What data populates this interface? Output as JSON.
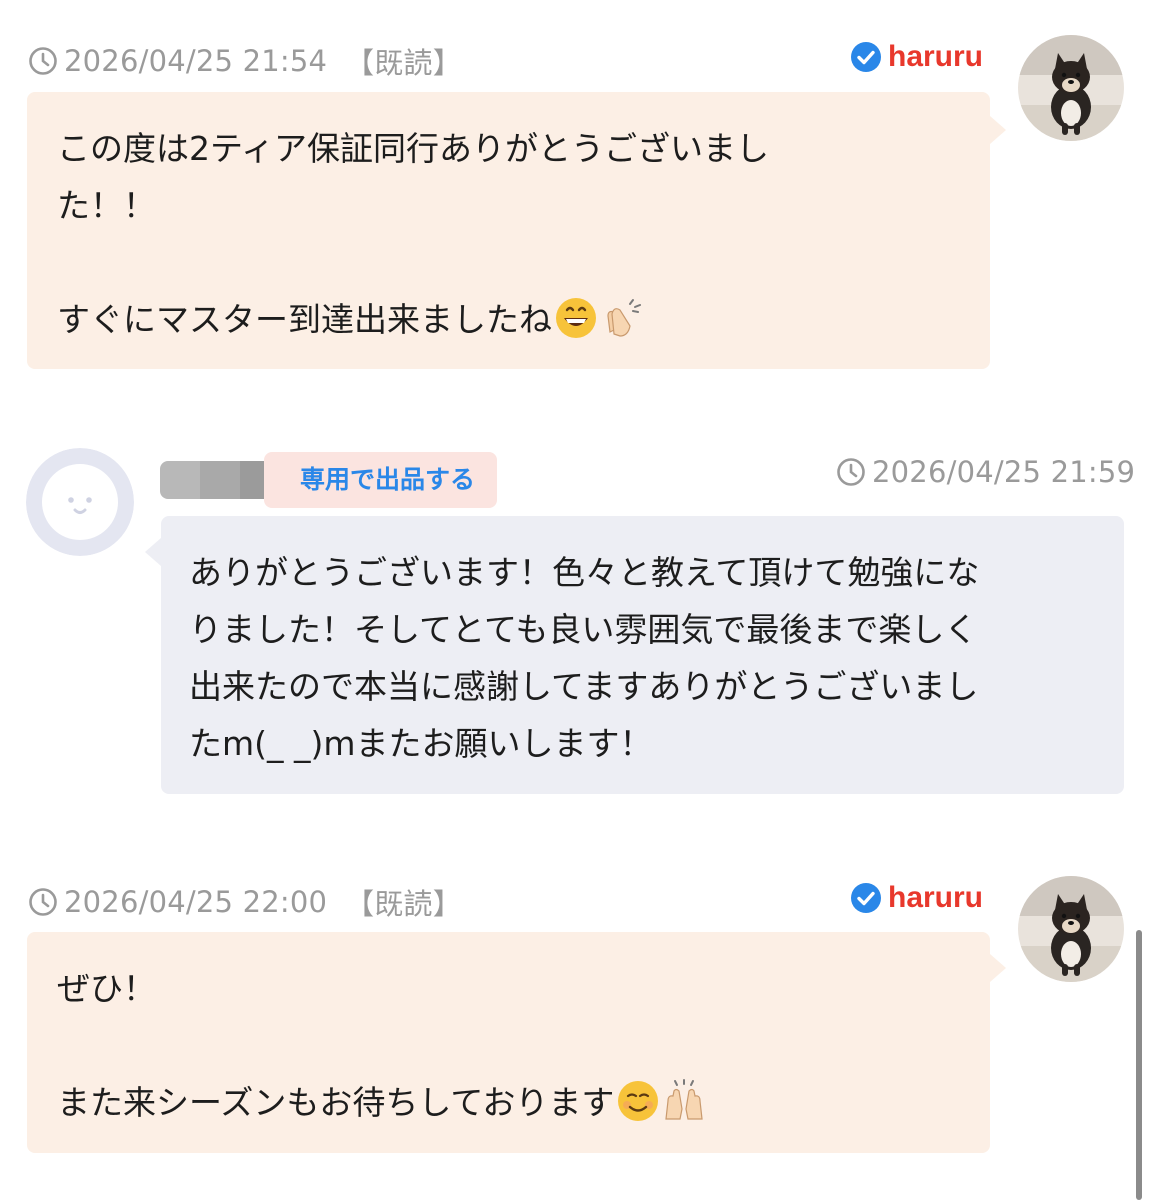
{
  "messages": [
    {
      "timestamp": "2026/04/25 21:54",
      "read_status": "【既読】",
      "user": "haruru",
      "lines": [
        "この度は2ティア保証同行ありがとうございまし",
        "た！！",
        "",
        "すぐにマスター到達出来ましたね"
      ],
      "emojis": [
        "grinning-face-emoji",
        "clapping-hands-emoji"
      ]
    },
    {
      "timestamp": "2026/04/25 21:59",
      "tag": "専用で出品する",
      "lines": [
        "ありがとうございます！色々と教えて頂けて勉強にな",
        "りました！そしてとても良い雰囲気で最後まで楽しく",
        "出来たので本当に感謝してますありがとうございまし",
        "たm(_ _)mまたお願いします！"
      ]
    },
    {
      "timestamp": "2026/04/25 22:00",
      "read_status": "【既読】",
      "user": "haruru",
      "lines": [
        "ぜひ！",
        "",
        "また来シーズンもお待ちしております"
      ],
      "emojis": [
        "smiling-face-emoji",
        "raising-hands-emoji"
      ]
    }
  ],
  "colors": {
    "seller_bubble": "#fcefe5",
    "buyer_bubble": "#edeef4",
    "username": "#e8382c",
    "verified": "#2a87e8",
    "meta_text": "#9a9a9a"
  }
}
